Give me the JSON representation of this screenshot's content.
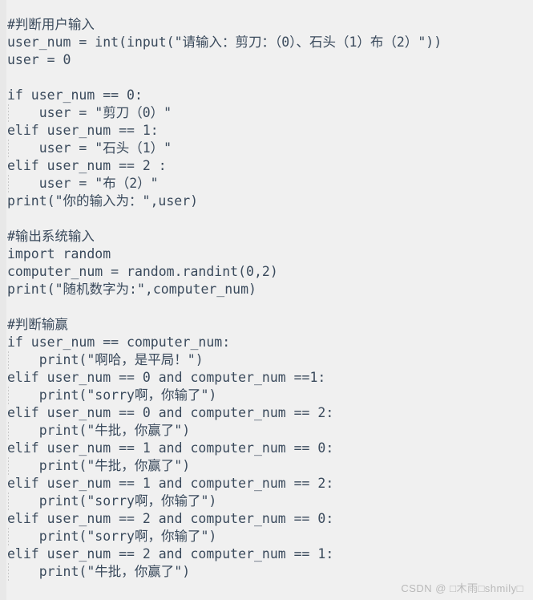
{
  "window": {
    "kind": "code-snippet",
    "language": "python",
    "background_color": "#f0f0f0",
    "gutter_color": "#e8e8e8",
    "text_color": "#3a4a5c",
    "indent_guide_color": "#c9c9c9"
  },
  "code": {
    "lines": [
      {
        "n": 1,
        "indent": 0,
        "text": "#判断用户输入"
      },
      {
        "n": 2,
        "indent": 0,
        "text": "user_num = int(input(\"请输入：剪刀：（0）、石头（1）布（2）\"))"
      },
      {
        "n": 3,
        "indent": 0,
        "text": "user = 0"
      },
      {
        "n": 4,
        "indent": 0,
        "text": ""
      },
      {
        "n": 5,
        "indent": 0,
        "text": "if user_num == 0:"
      },
      {
        "n": 6,
        "indent": 1,
        "text": "    user = \"剪刀（0）\""
      },
      {
        "n": 7,
        "indent": 0,
        "text": "elif user_num == 1:"
      },
      {
        "n": 8,
        "indent": 1,
        "text": "    user = \"石头（1）\""
      },
      {
        "n": 9,
        "indent": 0,
        "text": "elif user_num == 2 :"
      },
      {
        "n": 10,
        "indent": 1,
        "text": "    user = \"布（2）\""
      },
      {
        "n": 11,
        "indent": 0,
        "text": "print(\"你的输入为：\",user)"
      },
      {
        "n": 12,
        "indent": 0,
        "text": ""
      },
      {
        "n": 13,
        "indent": 0,
        "text": "#输出系统输入"
      },
      {
        "n": 14,
        "indent": 0,
        "text": "import random"
      },
      {
        "n": 15,
        "indent": 0,
        "text": "computer_num = random.randint(0,2)"
      },
      {
        "n": 16,
        "indent": 0,
        "text": "print(\"随机数字为:\",computer_num)"
      },
      {
        "n": 17,
        "indent": 0,
        "text": ""
      },
      {
        "n": 18,
        "indent": 0,
        "text": "#判断输赢"
      },
      {
        "n": 19,
        "indent": 0,
        "text": "if user_num == computer_num:"
      },
      {
        "n": 20,
        "indent": 1,
        "text": "    print(\"啊哈，是平局！\")"
      },
      {
        "n": 21,
        "indent": 0,
        "text": "elif user_num == 0 and computer_num ==1:"
      },
      {
        "n": 22,
        "indent": 1,
        "text": "    print(\"sorry啊，你输了\")"
      },
      {
        "n": 23,
        "indent": 0,
        "text": "elif user_num == 0 and computer_num == 2:"
      },
      {
        "n": 24,
        "indent": 1,
        "text": "    print(\"牛批，你赢了\")"
      },
      {
        "n": 25,
        "indent": 0,
        "text": "elif user_num == 1 and computer_num == 0:"
      },
      {
        "n": 26,
        "indent": 1,
        "text": "    print(\"牛批，你赢了\")"
      },
      {
        "n": 27,
        "indent": 0,
        "text": "elif user_num == 1 and computer_num == 2:"
      },
      {
        "n": 28,
        "indent": 1,
        "text": "    print(\"sorry啊，你输了\")"
      },
      {
        "n": 29,
        "indent": 0,
        "text": "elif user_num == 2 and computer_num == 0:"
      },
      {
        "n": 30,
        "indent": 1,
        "text": "    print(\"sorry啊，你输了\")"
      },
      {
        "n": 31,
        "indent": 0,
        "text": "elif user_num == 2 and computer_num == 1:"
      },
      {
        "n": 32,
        "indent": 1,
        "text": "    print(\"牛批，你赢了\")"
      }
    ]
  },
  "watermark": {
    "text": "CSDN @ □木雨□shmily□"
  }
}
